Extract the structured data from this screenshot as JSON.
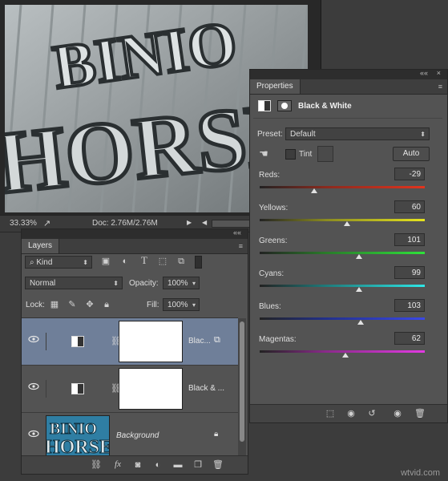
{
  "document": {
    "zoom": "33.33%",
    "doc_info": "Doc: 2.76M/2.76M",
    "canvas_text_top": "BINIO",
    "canvas_text_bottom": "HORSES"
  },
  "properties": {
    "tab": "Properties",
    "header_title": "Black & White",
    "preset_label": "Preset:",
    "preset_value": "Default",
    "tint_label": "Tint",
    "auto_label": "Auto",
    "sliders": [
      {
        "label": "Reds:",
        "value": "-29",
        "pos": 0.33,
        "gradient": "linear-gradient(to right,#222,#8a2a1e 40%,#e2341e)"
      },
      {
        "label": "Yellows:",
        "value": "60",
        "pos": 0.53,
        "gradient": "linear-gradient(to right,#222,#8a8a20 40%,#e6e41e)"
      },
      {
        "label": "Greens:",
        "value": "101",
        "pos": 0.6,
        "gradient": "linear-gradient(to right,#222,#2a7a2a 40%,#2ee23a)"
      },
      {
        "label": "Cyans:",
        "value": "99",
        "pos": 0.6,
        "gradient": "linear-gradient(to right,#222,#1f7a7a 40%,#2ee6e6)"
      },
      {
        "label": "Blues:",
        "value": "103",
        "pos": 0.61,
        "gradient": "linear-gradient(to right,#222,#22308a 40%,#3a48e6)"
      },
      {
        "label": "Magentas:",
        "value": "62",
        "pos": 0.52,
        "gradient": "linear-gradient(to right,#222,#8a2a8a 40%,#e23ae2)"
      }
    ]
  },
  "layers": {
    "tab": "Layers",
    "filter_kind": "Kind",
    "blend_mode": "Normal",
    "opacity_label": "Opacity:",
    "opacity_value": "100%",
    "lock_label": "Lock:",
    "fill_label": "Fill:",
    "fill_value": "100%",
    "rows": [
      {
        "name": "Blac...",
        "selected": true
      },
      {
        "name": "Black & ...",
        "selected": false
      },
      {
        "name": "Background",
        "selected": false
      }
    ]
  },
  "watermark": "wtvid.com",
  "colors": {
    "panel_bg": "#535353",
    "selected_row": "#6f7f99"
  }
}
